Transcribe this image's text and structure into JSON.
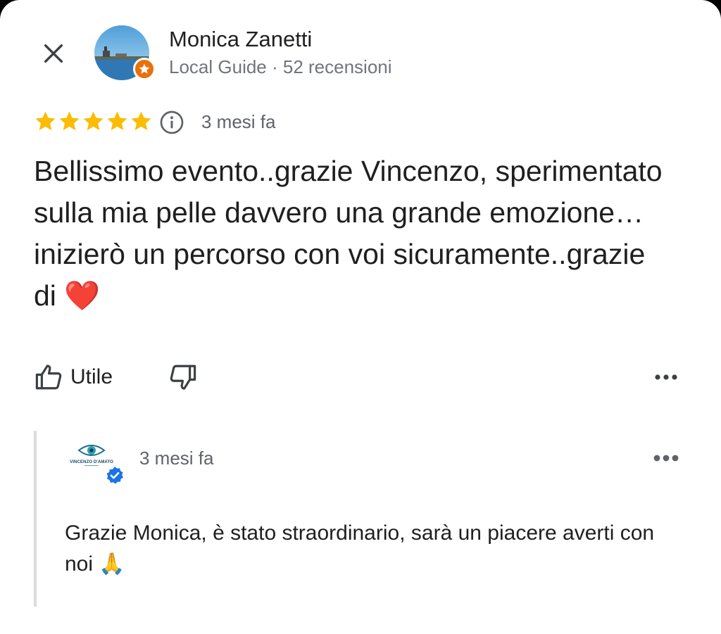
{
  "header": {
    "reviewer_name": "Monica Zanetti",
    "reviewer_meta": "Local Guide · 52 recensioni"
  },
  "review": {
    "rating": 5,
    "rating_max": 5,
    "time": "3 mesi fa",
    "text": "Bellissimo evento..grazie Vincenzo, sperimentato sulla mia pelle davvero una grande emozione…inizierò un percorso con voi sicuramente..grazie di ❤️"
  },
  "actions": {
    "helpful_label": "Utile"
  },
  "owner_reply": {
    "time": "3 mesi fa",
    "text": "Grazie Monica, è stato straordinario, sarà un piacere averti con noi 🙏",
    "logo_text": "VINCENZO D'AMATO"
  },
  "colors": {
    "star": "#fbbc04",
    "local_guide_badge": "#e8710a",
    "verified_badge": "#1a73e8",
    "secondary_text": "#70757a",
    "reply_bar": "#dadce0"
  },
  "icons": {
    "close": "close-icon",
    "star": "star-icon",
    "info": "info-icon",
    "thumb_up": "thumb-up-icon",
    "thumb_down": "thumb-down-icon",
    "more": "more-horizontal-icon",
    "verified": "verified-check-icon",
    "local_guide": "local-guide-star-icon"
  }
}
